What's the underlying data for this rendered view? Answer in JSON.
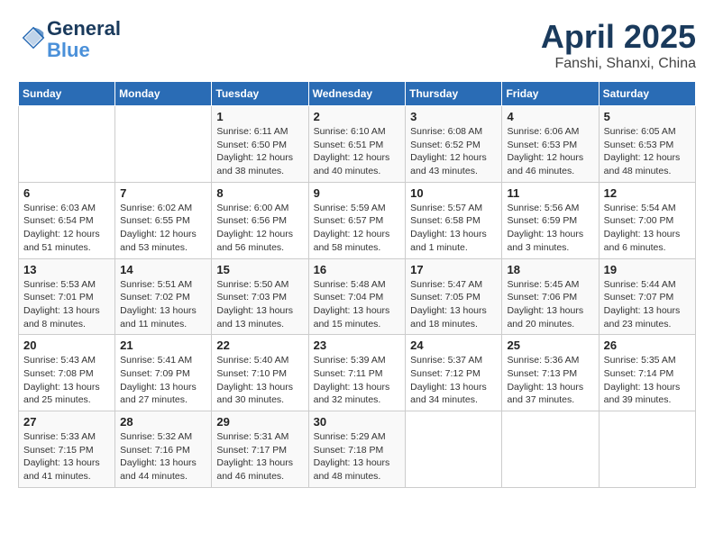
{
  "logo": {
    "line1": "General",
    "line2": "Blue"
  },
  "title": "April 2025",
  "subtitle": "Fanshi, Shanxi, China",
  "weekdays": [
    "Sunday",
    "Monday",
    "Tuesday",
    "Wednesday",
    "Thursday",
    "Friday",
    "Saturday"
  ],
  "weeks": [
    [
      null,
      null,
      {
        "day": "1",
        "sunrise": "6:11 AM",
        "sunset": "6:50 PM",
        "daylight": "12 hours and 38 minutes."
      },
      {
        "day": "2",
        "sunrise": "6:10 AM",
        "sunset": "6:51 PM",
        "daylight": "12 hours and 40 minutes."
      },
      {
        "day": "3",
        "sunrise": "6:08 AM",
        "sunset": "6:52 PM",
        "daylight": "12 hours and 43 minutes."
      },
      {
        "day": "4",
        "sunrise": "6:06 AM",
        "sunset": "6:53 PM",
        "daylight": "12 hours and 46 minutes."
      },
      {
        "day": "5",
        "sunrise": "6:05 AM",
        "sunset": "6:53 PM",
        "daylight": "12 hours and 48 minutes."
      }
    ],
    [
      {
        "day": "6",
        "sunrise": "6:03 AM",
        "sunset": "6:54 PM",
        "daylight": "12 hours and 51 minutes."
      },
      {
        "day": "7",
        "sunrise": "6:02 AM",
        "sunset": "6:55 PM",
        "daylight": "12 hours and 53 minutes."
      },
      {
        "day": "8",
        "sunrise": "6:00 AM",
        "sunset": "6:56 PM",
        "daylight": "12 hours and 56 minutes."
      },
      {
        "day": "9",
        "sunrise": "5:59 AM",
        "sunset": "6:57 PM",
        "daylight": "12 hours and 58 minutes."
      },
      {
        "day": "10",
        "sunrise": "5:57 AM",
        "sunset": "6:58 PM",
        "daylight": "13 hours and 1 minute."
      },
      {
        "day": "11",
        "sunrise": "5:56 AM",
        "sunset": "6:59 PM",
        "daylight": "13 hours and 3 minutes."
      },
      {
        "day": "12",
        "sunrise": "5:54 AM",
        "sunset": "7:00 PM",
        "daylight": "13 hours and 6 minutes."
      }
    ],
    [
      {
        "day": "13",
        "sunrise": "5:53 AM",
        "sunset": "7:01 PM",
        "daylight": "13 hours and 8 minutes."
      },
      {
        "day": "14",
        "sunrise": "5:51 AM",
        "sunset": "7:02 PM",
        "daylight": "13 hours and 11 minutes."
      },
      {
        "day": "15",
        "sunrise": "5:50 AM",
        "sunset": "7:03 PM",
        "daylight": "13 hours and 13 minutes."
      },
      {
        "day": "16",
        "sunrise": "5:48 AM",
        "sunset": "7:04 PM",
        "daylight": "13 hours and 15 minutes."
      },
      {
        "day": "17",
        "sunrise": "5:47 AM",
        "sunset": "7:05 PM",
        "daylight": "13 hours and 18 minutes."
      },
      {
        "day": "18",
        "sunrise": "5:45 AM",
        "sunset": "7:06 PM",
        "daylight": "13 hours and 20 minutes."
      },
      {
        "day": "19",
        "sunrise": "5:44 AM",
        "sunset": "7:07 PM",
        "daylight": "13 hours and 23 minutes."
      }
    ],
    [
      {
        "day": "20",
        "sunrise": "5:43 AM",
        "sunset": "7:08 PM",
        "daylight": "13 hours and 25 minutes."
      },
      {
        "day": "21",
        "sunrise": "5:41 AM",
        "sunset": "7:09 PM",
        "daylight": "13 hours and 27 minutes."
      },
      {
        "day": "22",
        "sunrise": "5:40 AM",
        "sunset": "7:10 PM",
        "daylight": "13 hours and 30 minutes."
      },
      {
        "day": "23",
        "sunrise": "5:39 AM",
        "sunset": "7:11 PM",
        "daylight": "13 hours and 32 minutes."
      },
      {
        "day": "24",
        "sunrise": "5:37 AM",
        "sunset": "7:12 PM",
        "daylight": "13 hours and 34 minutes."
      },
      {
        "day": "25",
        "sunrise": "5:36 AM",
        "sunset": "7:13 PM",
        "daylight": "13 hours and 37 minutes."
      },
      {
        "day": "26",
        "sunrise": "5:35 AM",
        "sunset": "7:14 PM",
        "daylight": "13 hours and 39 minutes."
      }
    ],
    [
      {
        "day": "27",
        "sunrise": "5:33 AM",
        "sunset": "7:15 PM",
        "daylight": "13 hours and 41 minutes."
      },
      {
        "day": "28",
        "sunrise": "5:32 AM",
        "sunset": "7:16 PM",
        "daylight": "13 hours and 44 minutes."
      },
      {
        "day": "29",
        "sunrise": "5:31 AM",
        "sunset": "7:17 PM",
        "daylight": "13 hours and 46 minutes."
      },
      {
        "day": "30",
        "sunrise": "5:29 AM",
        "sunset": "7:18 PM",
        "daylight": "13 hours and 48 minutes."
      },
      null,
      null,
      null
    ]
  ]
}
